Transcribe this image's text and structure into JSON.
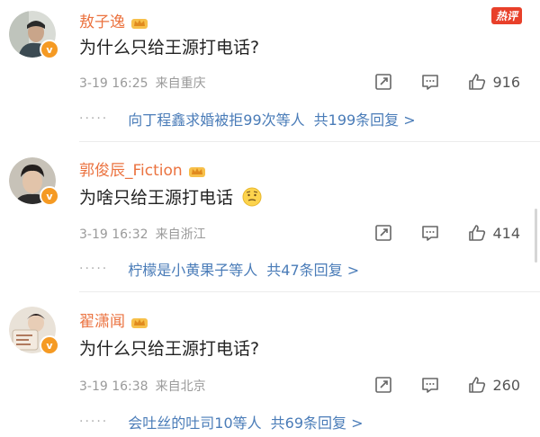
{
  "hot_label": "热评",
  "comments": [
    {
      "username": "敖子逸",
      "text": "为什么只给王源打电话?",
      "date": "3-19 16:25",
      "location": "来自重庆",
      "likes": "916",
      "reply_from": "向丁程鑫求婚被拒99次等人",
      "reply_total": "共199条回复 >"
    },
    {
      "username": "郭俊辰_Fiction",
      "text": "为啥只给王源打电话",
      "date": "3-19 16:32",
      "location": "来自浙江",
      "likes": "414",
      "reply_from": "柠檬是小黄果子等人",
      "reply_total": "共47条回复 >"
    },
    {
      "username": "翟潇闻",
      "text": "为什么只给王源打电话?",
      "date": "3-19 16:38",
      "location": "来自北京",
      "likes": "260",
      "reply_from": "会吐丝的吐司10等人",
      "reply_total": "共69条回复 >"
    }
  ],
  "icons": {
    "verified": "v-badge-icon",
    "crown": "crown-icon",
    "share": "share-icon",
    "comment": "comment-icon",
    "like": "thumb-up-icon",
    "emoji": "thinking-face-icon"
  },
  "colors": {
    "username": "#eb7340",
    "reply_link": "#4a7cb8",
    "meta": "#9a9a9a",
    "badge": "#f59a23"
  }
}
